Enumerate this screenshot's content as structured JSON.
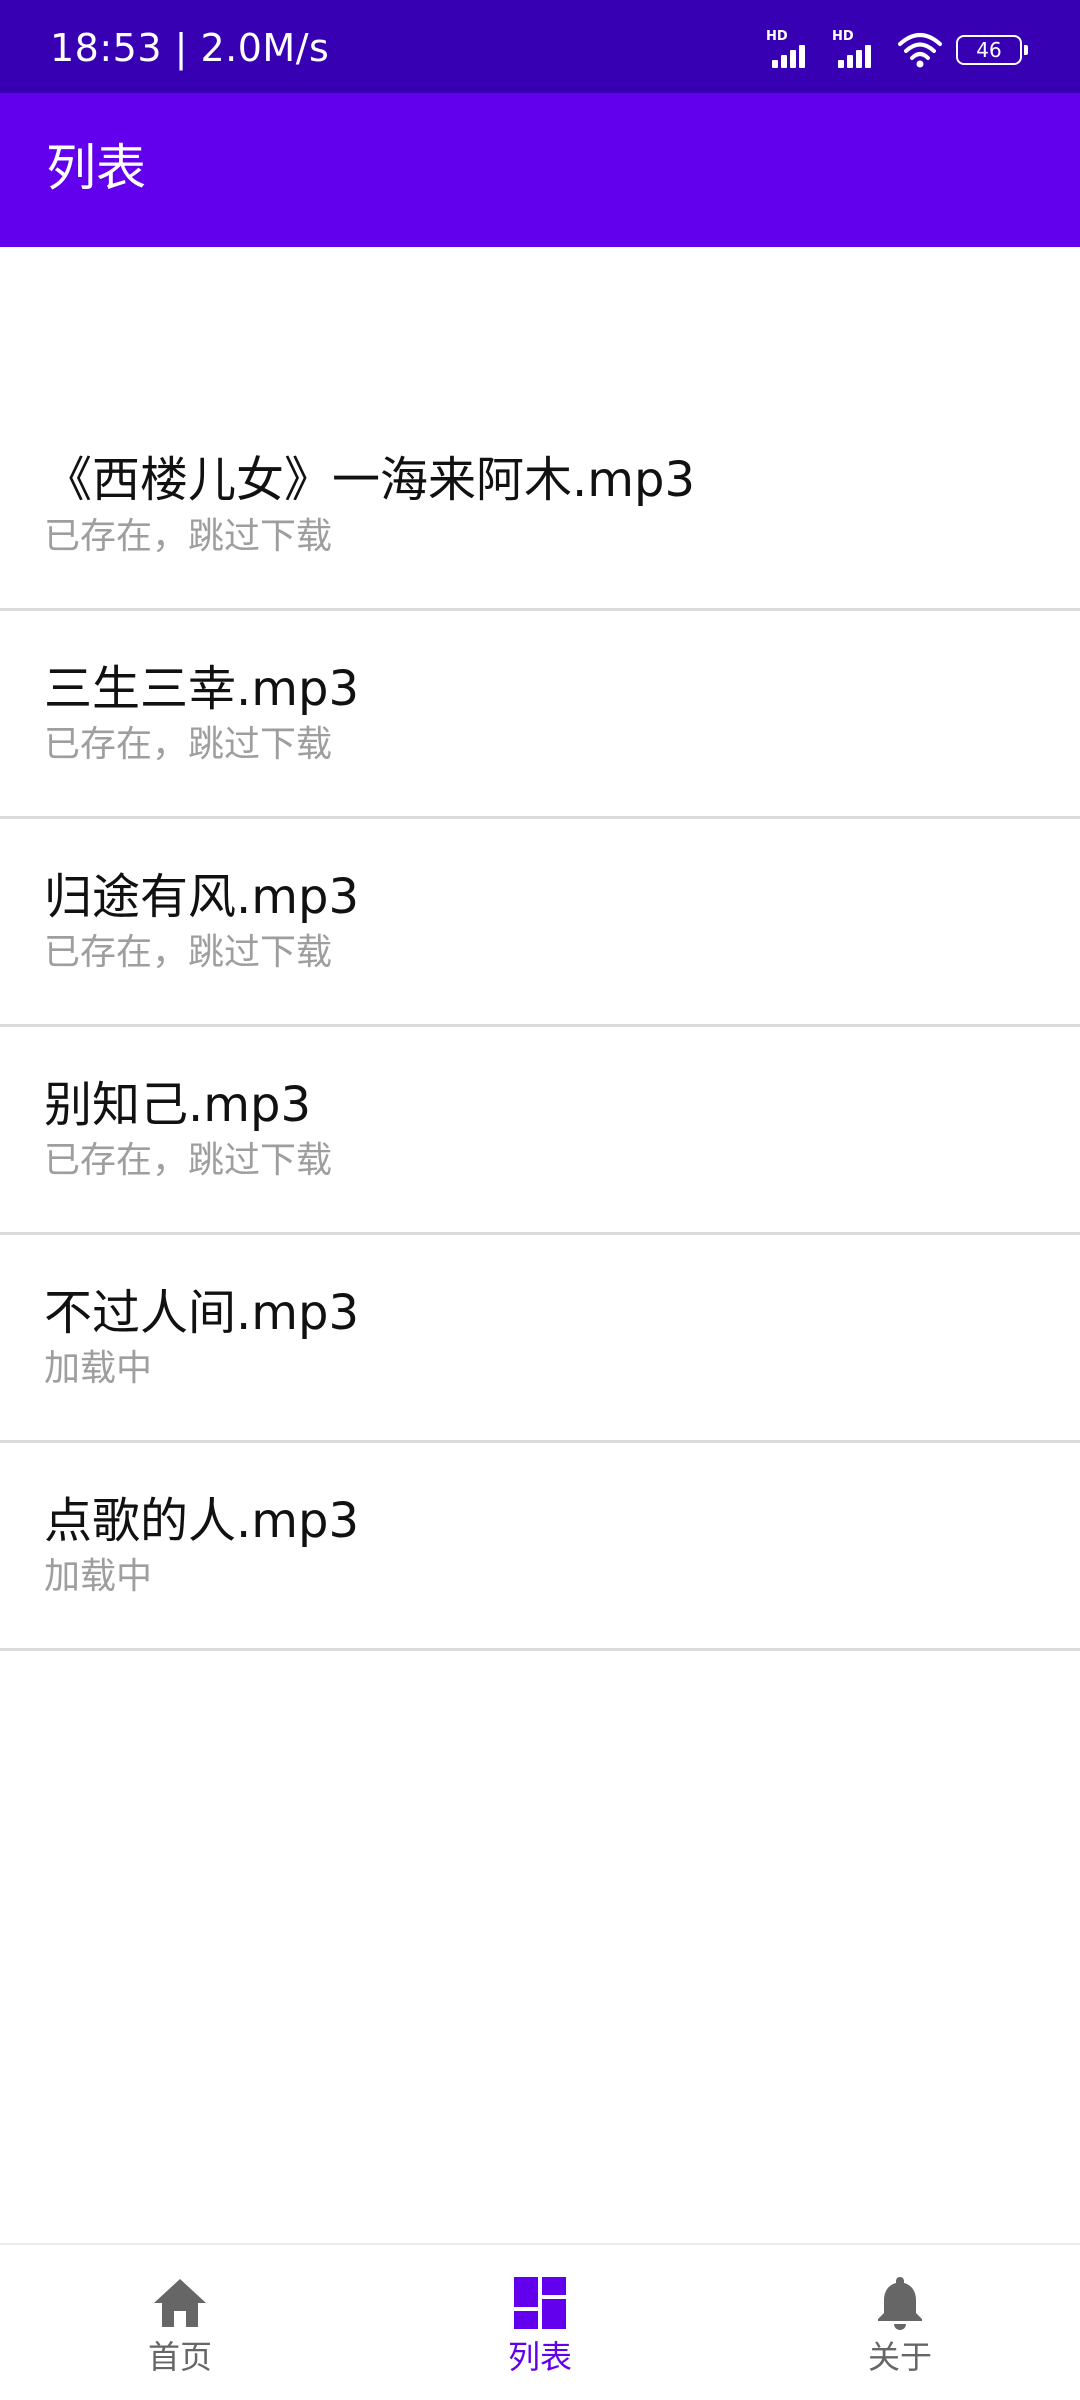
{
  "status_bar": {
    "time": "18:53 | 2.0M/s",
    "signal_label": "HD",
    "battery_level": "46"
  },
  "app_bar": {
    "title": "列表"
  },
  "list": {
    "items": [
      {
        "title": "《西楼儿女》一海来阿木.mp3",
        "status": "已存在，跳过下载"
      },
      {
        "title": "三生三幸.mp3",
        "status": "已存在，跳过下载"
      },
      {
        "title": "归途有风.mp3",
        "status": "已存在，跳过下载"
      },
      {
        "title": "别知己.mp3",
        "status": "已存在，跳过下载"
      },
      {
        "title": "不过人间.mp3",
        "status": "加载中"
      },
      {
        "title": "点歌的人.mp3",
        "status": "加载中"
      }
    ]
  },
  "bottom_nav": {
    "items": [
      {
        "label": "首页",
        "icon": "home-icon",
        "active": false
      },
      {
        "label": "列表",
        "icon": "dashboard-icon",
        "active": true
      },
      {
        "label": "关于",
        "icon": "bell-icon",
        "active": false
      }
    ]
  },
  "colors": {
    "status_bar": "#3700b3",
    "app_bar": "#6200ee",
    "active_nav": "#6200ee",
    "inactive_nav": "#666666"
  }
}
